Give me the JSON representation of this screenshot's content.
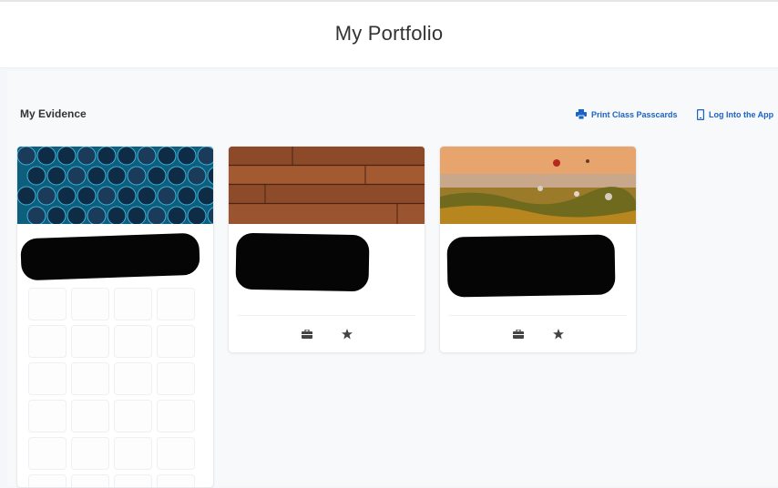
{
  "header": {
    "title": "My Portfolio"
  },
  "section": {
    "title": "My Evidence"
  },
  "actions": {
    "print_passcards": "Print Class Passcards",
    "log_into_app": "Log Into the App"
  },
  "cards": [
    {
      "banner": "blue glass marbles",
      "title_redacted": true
    },
    {
      "banner": "wood planks",
      "title_redacted": true,
      "footer_icons": [
        "briefcase-icon",
        "star-icon"
      ]
    },
    {
      "banner": "hot air balloons landscape",
      "title_redacted": true,
      "footer_icons": [
        "briefcase-icon",
        "star-icon"
      ]
    }
  ],
  "colors": {
    "link": "#1a63c6",
    "title": "#333333",
    "background": "#f4f6f9"
  }
}
